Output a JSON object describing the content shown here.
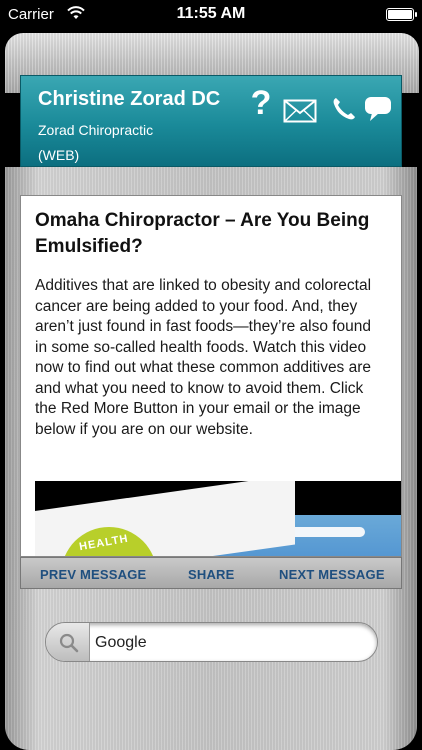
{
  "status_bar": {
    "carrier": "Carrier",
    "time": "11:55 AM",
    "wifi_icon": "wifi-icon",
    "battery_icon": "battery-icon"
  },
  "header": {
    "name": "Christine Zorad DC",
    "organization": "Zorad Chiropractic",
    "source_type": "(WEB)",
    "icons": [
      "question-icon",
      "mail-icon",
      "phone-icon",
      "chat-icon"
    ],
    "question_glyph": "?",
    "accent_color": "#1a8a99"
  },
  "article": {
    "title": "Omaha Chiropractor – Are You Being Emulsified?",
    "body": "Additives that are linked to obesity and colorectal cancer are being added to your food. And, they aren’t just found in fast foods—they’re also found in some so-called health foods. Watch this video now to find out what these common additives are and what you need to know to avoid them. Click the Red More Button in your email or the image below if you are on our website.",
    "video_badge_text": "HEALTH"
  },
  "toolbar": {
    "prev_label": "PREV MESSAGE",
    "share_label": "SHARE",
    "next_label": "NEXT MESSAGE",
    "label_color": "#1f4f7f"
  },
  "search": {
    "value": "Google",
    "icon": "search-icon"
  }
}
